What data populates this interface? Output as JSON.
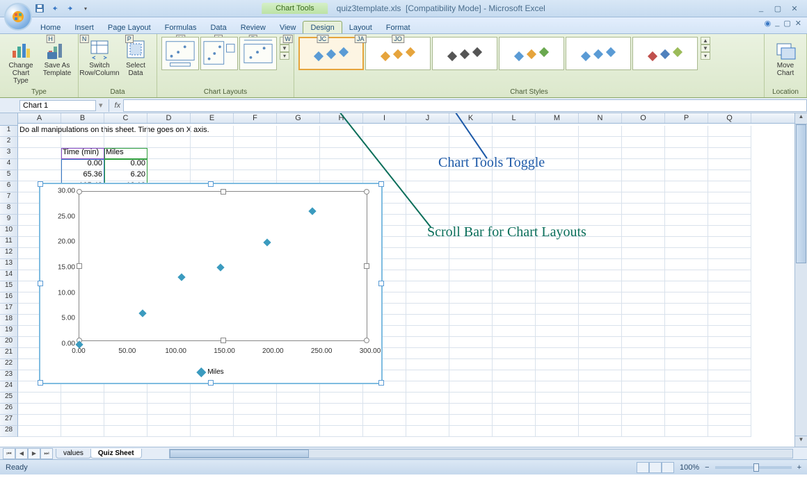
{
  "title": {
    "context": "Chart Tools",
    "filename": "quiz3template.xls",
    "mode": "[Compatibility Mode]",
    "app": "Microsoft Excel"
  },
  "tabs": {
    "items": [
      {
        "label": "Home",
        "key": "H"
      },
      {
        "label": "Insert",
        "key": "N"
      },
      {
        "label": "Page Layout",
        "key": "P"
      },
      {
        "label": "Formulas",
        "key": "M"
      },
      {
        "label": "Data",
        "key": "A"
      },
      {
        "label": "Review",
        "key": "R"
      },
      {
        "label": "View",
        "key": "W"
      },
      {
        "label": "Design",
        "key": "JC"
      },
      {
        "label": "Layout",
        "key": "JA"
      },
      {
        "label": "Format",
        "key": "JO"
      }
    ],
    "active": 7
  },
  "ribbon": {
    "groups": {
      "type": {
        "label": "Type",
        "btn1": "Change Chart Type",
        "btn2": "Save As Template"
      },
      "data": {
        "label": "Data",
        "btn1": "Switch Row/Column",
        "btn2": "Select Data"
      },
      "layouts": {
        "label": "Chart Layouts"
      },
      "styles": {
        "label": "Chart Styles"
      },
      "location": {
        "label": "Location",
        "btn": "Move Chart"
      }
    }
  },
  "namebox": "Chart 1",
  "worksheet": {
    "cols": [
      "A",
      "B",
      "C",
      "D",
      "E",
      "F",
      "G",
      "H",
      "I",
      "J",
      "K",
      "L",
      "M",
      "N",
      "O",
      "P",
      "Q"
    ],
    "instruction": "Do all manipulations on this sheet.  Time goes on X axis.",
    "headers": {
      "b": "Time (min)",
      "c": "Miles"
    },
    "rows": [
      {
        "b": "0.00",
        "c": "0.00"
      },
      {
        "b": "65.36",
        "c": "6.20"
      },
      {
        "b": "105.43",
        "c": "13.18"
      }
    ]
  },
  "chart_data": {
    "type": "scatter",
    "x": [
      0.0,
      65.36,
      105.43,
      145,
      193,
      240
    ],
    "y": [
      0.0,
      6.2,
      13.18,
      15.2,
      20.0,
      26.2
    ],
    "series_name": "Miles",
    "xlim": [
      0,
      300
    ],
    "ylim": [
      0,
      30
    ],
    "xticks": [
      0,
      50,
      100,
      150,
      200,
      250,
      300
    ],
    "yticks": [
      0,
      5,
      10,
      15,
      20,
      25,
      30
    ],
    "xtick_labels": [
      "0.00",
      "50.00",
      "100.00",
      "150.00",
      "200.00",
      "250.00",
      "300.00"
    ],
    "ytick_labels": [
      "0.00",
      "5.00",
      "10.00",
      "15.00",
      "20.00",
      "25.00",
      "30.00"
    ]
  },
  "annotations": {
    "a1": "Chart Tools Toggle",
    "a2": "Scroll Bar for Chart Layouts"
  },
  "sheets": {
    "tabs": [
      "values",
      "Quiz Sheet"
    ],
    "active": 1
  },
  "status": {
    "ready": "Ready",
    "zoom": "100%"
  }
}
